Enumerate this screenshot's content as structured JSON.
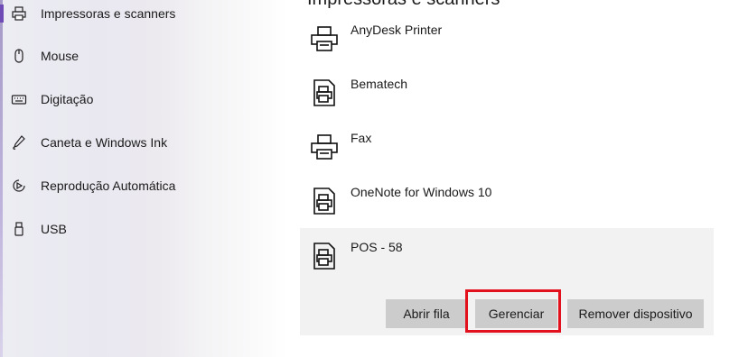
{
  "sidebar": {
    "items": [
      {
        "label": "Impressoras e scanners",
        "icon": "printer-icon"
      },
      {
        "label": "Mouse",
        "icon": "mouse-icon"
      },
      {
        "label": "Digitação",
        "icon": "keyboard-icon"
      },
      {
        "label": "Caneta e Windows Ink",
        "icon": "pen-icon"
      },
      {
        "label": "Reprodução Automática",
        "icon": "autoplay-icon"
      },
      {
        "label": "USB",
        "icon": "usb-icon"
      }
    ]
  },
  "main": {
    "title": "Impressoras e scanners",
    "printers": [
      {
        "name": "AnyDesk Printer",
        "icon": "printer-icon"
      },
      {
        "name": "Bematech",
        "icon": "printer-document-icon"
      },
      {
        "name": "Fax",
        "icon": "printer-icon"
      },
      {
        "name": "OneNote for Windows 10",
        "icon": "printer-document-icon"
      },
      {
        "name": "POS - 58",
        "icon": "printer-document-icon"
      }
    ],
    "actions": {
      "open_queue": "Abrir fila",
      "manage": "Gerenciar",
      "remove": "Remover dispositivo"
    }
  },
  "colors": {
    "highlight": "#e3111e",
    "button_bg": "#cccccc",
    "selected_row_bg": "#f2f2f2",
    "selection_accent": "#6e4bb5"
  }
}
